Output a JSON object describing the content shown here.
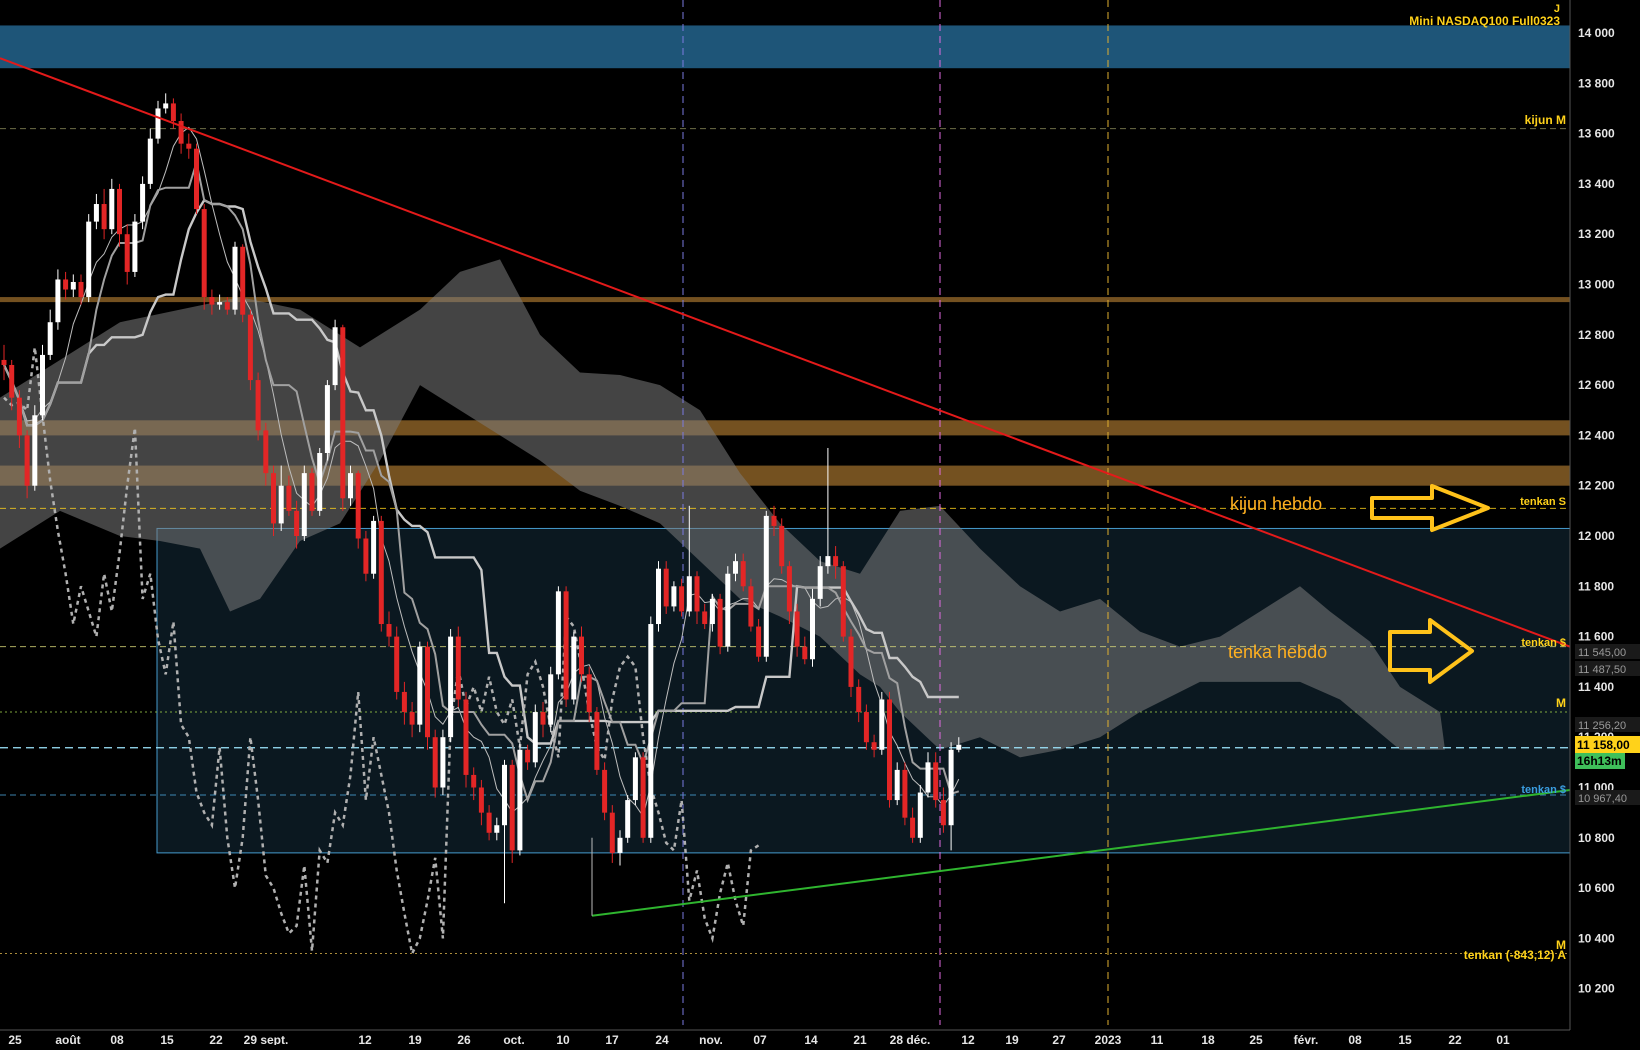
{
  "app": {
    "instrument": "Mini NASDAQ100 Full0323",
    "timeframe_marker": "J"
  },
  "colors": {
    "background": "#000000",
    "up_candle": "#ffffff",
    "down_candle": "#e32626",
    "resistance_zone": "#1e5578",
    "brown_zone": "#7a5522",
    "range_box_border": "#4aa3d8",
    "range_box_fill": "#0c1a22",
    "cloud_fill": "#7b7b7b",
    "trendline_down": "#e31a1a",
    "trendline_up": "#2fb52f",
    "label_yellow": "#ffd21a",
    "label_blue": "#3a9de0",
    "axis_text": "#e6e6e6"
  },
  "price_labels": {
    "current": "11 158,00",
    "countdown": "16h13m",
    "tags": [
      "11 545,00",
      "11 487,50",
      "11 256,20",
      "10 967,40"
    ]
  },
  "level_labels": {
    "kijun_m": "kijun M",
    "tenkan_kijun_s": "tenkan S",
    "tenkan_dollar": "tenkan $",
    "m_mid": "M",
    "tenkan_blue": "tenkan $",
    "tenkan_bottom": "tenkan (-843,12) A",
    "m_bottom": "M"
  },
  "annotations": {
    "kijun_hebdo": "kijun hebdo",
    "tenka_hebdo": "tenka hebdo"
  },
  "chart_data": {
    "type": "candlestick",
    "title": "Mini NASDAQ100 Full0323",
    "y_axis": {
      "ticks": [
        "14 000",
        "13 800",
        "13 600",
        "13 400",
        "13 200",
        "13 000",
        "12 800",
        "12 600",
        "12 400",
        "12 200",
        "12 000",
        "11 800",
        "11 600",
        "11 400",
        "11 200",
        "11 000",
        "10 800",
        "10 600",
        "10 400",
        "10 200"
      ],
      "range": [
        10120,
        14080
      ]
    },
    "x_axis": {
      "ticks": [
        "25",
        "août",
        "08",
        "15",
        "22",
        "29 sept.",
        "12",
        "19",
        "26",
        "oct.",
        "10",
        "17",
        "24",
        "nov.",
        "07",
        "14",
        "21",
        "28 déc.",
        "12",
        "19",
        "27",
        "2023",
        "11",
        "18",
        "25",
        "févr.",
        "08",
        "15",
        "22",
        "01"
      ]
    },
    "horizontal_levels": [
      {
        "name": "kijun M",
        "value": 13620
      },
      {
        "name": "kijun hebdo / tenkan S",
        "value": 12110
      },
      {
        "name": "tenkan $ / tenka hebdo",
        "value": 11560
      },
      {
        "name": "M",
        "value": 11300
      },
      {
        "name": "tenkan $",
        "value": 10970
      },
      {
        "name": "tenkan (-843,12) A",
        "value": 10340
      }
    ],
    "zones": [
      {
        "name": "resistance",
        "from": 13860,
        "to": 14030
      },
      {
        "name": "brown-1",
        "from": 12930,
        "to": 12950
      },
      {
        "name": "brown-2",
        "from": 12400,
        "to": 12460
      },
      {
        "name": "brown-3",
        "from": 12200,
        "to": 12280
      }
    ],
    "range_box": {
      "from": 10740,
      "to": 12030
    },
    "candles": [
      [
        12700,
        12680,
        12760,
        12620
      ],
      [
        12680,
        12550,
        12700,
        12500
      ],
      [
        12550,
        12400,
        12580,
        12350
      ],
      [
        12400,
        12200,
        12420,
        12150
      ],
      [
        12200,
        12480,
        12520,
        12180
      ],
      [
        12480,
        12720,
        12760,
        12460
      ],
      [
        12720,
        12850,
        12900,
        12700
      ],
      [
        12850,
        13020,
        13060,
        12820
      ],
      [
        13020,
        12980,
        13050,
        12940
      ],
      [
        12980,
        13010,
        13040,
        12950
      ],
      [
        13010,
        12950,
        13040,
        12920
      ],
      [
        12950,
        13250,
        13280,
        12930
      ],
      [
        13250,
        13320,
        13360,
        13220
      ],
      [
        13320,
        13220,
        13380,
        13180
      ],
      [
        13220,
        13380,
        13420,
        13200
      ],
      [
        13380,
        13200,
        13400,
        13150
      ],
      [
        13200,
        13050,
        13240,
        13000
      ],
      [
        13050,
        13250,
        13280,
        13030
      ],
      [
        13250,
        13400,
        13430,
        13220
      ],
      [
        13400,
        13580,
        13620,
        13380
      ],
      [
        13580,
        13700,
        13730,
        13560
      ],
      [
        13700,
        13720,
        13760,
        13680
      ],
      [
        13720,
        13650,
        13740,
        13620
      ],
      [
        13650,
        13560,
        13680,
        13520
      ],
      [
        13560,
        13540,
        13600,
        13500
      ],
      [
        13540,
        13300,
        13560,
        13280
      ],
      [
        13300,
        12950,
        13320,
        12900
      ],
      [
        12950,
        12920,
        12980,
        12880
      ],
      [
        12920,
        12930,
        12960,
        12900
      ],
      [
        12930,
        12900,
        12950,
        12880
      ],
      [
        12900,
        13150,
        13170,
        12880
      ],
      [
        13150,
        12880,
        13160,
        12850
      ],
      [
        12880,
        12620,
        12900,
        12580
      ],
      [
        12620,
        12420,
        12650,
        12380
      ],
      [
        12420,
        12250,
        12450,
        12200
      ],
      [
        12250,
        12050,
        12280,
        12000
      ],
      [
        12050,
        12200,
        12280,
        12020
      ],
      [
        12200,
        12100,
        12240,
        12080
      ],
      [
        12100,
        12000,
        12140,
        11950
      ],
      [
        12000,
        12250,
        12280,
        11980
      ],
      [
        12250,
        12100,
        12270,
        12080
      ],
      [
        12100,
        12330,
        12350,
        12080
      ],
      [
        12330,
        12600,
        12620,
        12300
      ],
      [
        12600,
        12830,
        12860,
        12580
      ],
      [
        12830,
        12150,
        12840,
        12100
      ],
      [
        12150,
        12250,
        12280,
        12120
      ],
      [
        12250,
        11990,
        12260,
        11950
      ],
      [
        11990,
        11850,
        12020,
        11820
      ],
      [
        11850,
        12060,
        12080,
        11830
      ],
      [
        12060,
        11650,
        12080,
        11620
      ],
      [
        11650,
        11600,
        11700,
        11560
      ],
      [
        11600,
        11380,
        11640,
        11350
      ],
      [
        11380,
        11300,
        11420,
        11250
      ],
      [
        11300,
        11250,
        11340,
        11200
      ],
      [
        11250,
        11560,
        11580,
        11220
      ],
      [
        11560,
        11200,
        11580,
        11150
      ],
      [
        11200,
        11000,
        11230,
        10960
      ],
      [
        11000,
        11200,
        11230,
        10970
      ],
      [
        11200,
        11600,
        11630,
        11180
      ],
      [
        11600,
        11350,
        11640,
        11320
      ],
      [
        11350,
        11050,
        11380,
        11000
      ],
      [
        11050,
        11000,
        11080,
        10950
      ],
      [
        11000,
        10900,
        11030,
        10850
      ],
      [
        10900,
        10820,
        10930,
        10790
      ],
      [
        10820,
        10850,
        10880,
        10790
      ],
      [
        10850,
        11090,
        11110,
        10540
      ],
      [
        11090,
        10750,
        11110,
        10700
      ],
      [
        10750,
        11150,
        11180,
        10730
      ],
      [
        11150,
        11100,
        11170,
        11070
      ],
      [
        11100,
        11300,
        11330,
        11080
      ],
      [
        11300,
        11250,
        11340,
        11200
      ],
      [
        11250,
        11450,
        11480,
        11220
      ],
      [
        11450,
        11780,
        11800,
        11430
      ],
      [
        11780,
        11350,
        11800,
        11320
      ],
      [
        11350,
        11600,
        11620,
        11330
      ],
      [
        11600,
        11450,
        11640,
        11420
      ],
      [
        11450,
        11300,
        11480,
        11260
      ],
      [
        11300,
        11070,
        11320,
        11050
      ],
      [
        11070,
        10900,
        11100,
        10870
      ],
      [
        10900,
        10740,
        10930,
        10700
      ],
      [
        10740,
        10800,
        10830,
        10690
      ],
      [
        10800,
        10950,
        10970,
        10780
      ],
      [
        10950,
        11120,
        11140,
        10930
      ],
      [
        11120,
        10800,
        11140,
        10780
      ],
      [
        10800,
        11650,
        11680,
        10780
      ],
      [
        11650,
        11870,
        11900,
        11620
      ],
      [
        11870,
        11720,
        11900,
        11690
      ],
      [
        11720,
        11800,
        11820,
        11700
      ],
      [
        11800,
        11700,
        11830,
        11680
      ],
      [
        11700,
        11840,
        12120,
        11680
      ],
      [
        11840,
        11700,
        11860,
        11650
      ],
      [
        11700,
        11650,
        11730,
        11630
      ],
      [
        11650,
        11750,
        11770,
        11620
      ],
      [
        11750,
        11560,
        11770,
        11530
      ],
      [
        11560,
        11850,
        11880,
        11540
      ],
      [
        11850,
        11900,
        11930,
        11820
      ],
      [
        11900,
        11800,
        11930,
        11780
      ],
      [
        11800,
        11640,
        11830,
        11620
      ],
      [
        11640,
        11520,
        11670,
        11500
      ],
      [
        11520,
        12080,
        12100,
        11500
      ],
      [
        12080,
        12040,
        12120,
        12000
      ],
      [
        12040,
        11880,
        12070,
        11850
      ],
      [
        11880,
        11700,
        11900,
        11650
      ],
      [
        11700,
        11560,
        11730,
        11520
      ],
      [
        11560,
        11510,
        11600,
        11490
      ],
      [
        11510,
        11750,
        11790,
        11480
      ],
      [
        11750,
        11880,
        11920,
        11720
      ],
      [
        11880,
        11920,
        12350,
        11850
      ],
      [
        11920,
        11880,
        11960,
        11830
      ],
      [
        11880,
        11600,
        11900,
        11580
      ],
      [
        11600,
        11400,
        11630,
        11360
      ],
      [
        11400,
        11300,
        11430,
        11260
      ],
      [
        11300,
        11180,
        11330,
        11150
      ],
      [
        11180,
        11150,
        11210,
        11120
      ],
      [
        11150,
        11350,
        11380,
        11130
      ],
      [
        11350,
        10950,
        11380,
        10920
      ],
      [
        10950,
        11070,
        11100,
        10930
      ],
      [
        11070,
        10880,
        11100,
        10850
      ],
      [
        10880,
        10800,
        10920,
        10780
      ],
      [
        10800,
        10980,
        11010,
        10780
      ],
      [
        10980,
        11100,
        11140,
        10960
      ],
      [
        11100,
        10950,
        11140,
        10920
      ],
      [
        10950,
        10850,
        11000,
        10820
      ],
      [
        10850,
        11150,
        11180,
        10750
      ],
      [
        11150,
        11170,
        11200,
        11140
      ]
    ]
  }
}
